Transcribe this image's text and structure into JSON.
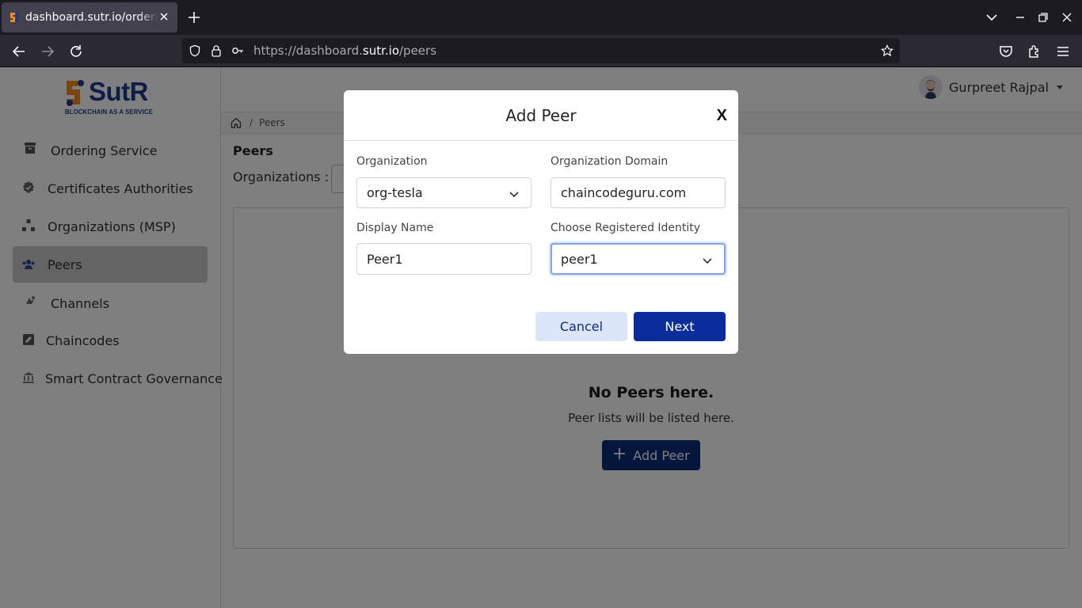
{
  "browser": {
    "tab_title": "dashboard.sutr.io/ordering",
    "url_prefix": "https://dashboard.",
    "url_domain": "sutr.io",
    "url_path": "/peers"
  },
  "app": {
    "logo_text": "SutR",
    "logo_tagline": "BLOCKCHAIN AS A SERVICE",
    "brand_color": "#1b3a8c",
    "accent_color": "#f28c1a"
  },
  "sidebar": {
    "items": [
      {
        "label": "Ordering Service",
        "icon": "archive-icon"
      },
      {
        "label": "Certificates Authorities",
        "icon": "badge-check-icon"
      },
      {
        "label": "Organizations (MSP)",
        "icon": "sitemap-icon"
      },
      {
        "label": "Peers",
        "icon": "users-icon",
        "active": true
      },
      {
        "label": "Channels",
        "icon": "broadcast-icon"
      },
      {
        "label": "Chaincodes",
        "icon": "edit-square-icon"
      },
      {
        "label": "Smart Contract Governance",
        "icon": "bank-icon"
      }
    ]
  },
  "header": {
    "user_name": "Gurpreet Rajpal"
  },
  "breadcrumb": {
    "current": "Peers"
  },
  "main": {
    "title": "Peers",
    "org_label": "Organizations :",
    "empty_title": "No Peers here.",
    "empty_subtitle": "Peer lists will be listed here.",
    "add_button": "Add Peer"
  },
  "modal": {
    "title": "Add Peer",
    "close_label": "X",
    "organization_label": "Organization",
    "organization_value": "org-tesla",
    "domain_label": "Organization Domain",
    "domain_value": "chaincodeguru.com",
    "display_name_label": "Display Name",
    "display_name_value": "Peer1",
    "identity_label": "Choose Registered Identity",
    "identity_value": "peer1",
    "cancel_label": "Cancel",
    "next_label": "Next"
  }
}
